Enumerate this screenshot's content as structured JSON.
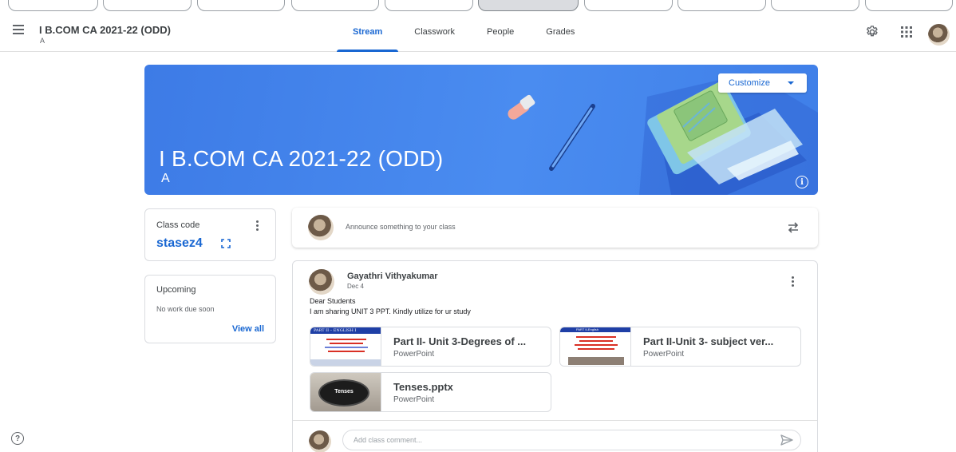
{
  "header": {
    "class_name": "I B.COM CA 2021-22 (ODD)",
    "section": "A",
    "tabs": [
      {
        "label": "Stream",
        "active": true
      },
      {
        "label": "Classwork",
        "active": false
      },
      {
        "label": "People",
        "active": false
      },
      {
        "label": "Grades",
        "active": false
      }
    ],
    "icons": [
      "menu-icon",
      "settings-icon",
      "apps-icon",
      "account-avatar"
    ]
  },
  "banner": {
    "title": "I B.COM CA 2021-22 (ODD)",
    "section": "A",
    "customize_label": "Customize",
    "color": "#4285f4"
  },
  "class_code": {
    "label": "Class code",
    "code": "stasez4"
  },
  "upcoming": {
    "label": "Upcoming",
    "message": "No work due soon",
    "view_all": "View all"
  },
  "announce": {
    "placeholder": "Announce something to your class"
  },
  "post": {
    "author": "Gayathri Vithyakumar",
    "date": "Dec 4",
    "line1": "Dear Students",
    "line2": "I am sharing UNIT 3 PPT. Kindly utilize for ur study",
    "attachments": [
      {
        "name": "Part II- Unit 3-Degrees of ...",
        "type": "PowerPoint",
        "thumb_heading": "PART II – ENGLISH I"
      },
      {
        "name": "Part II-Unit 3- subject ver...",
        "type": "PowerPoint",
        "thumb_heading": "PART II-English"
      },
      {
        "name": "Tenses.pptx",
        "type": "PowerPoint",
        "thumb_heading": "Tenses"
      }
    ],
    "comment_placeholder": "Add class comment..."
  },
  "colors": {
    "accent": "#1967d2",
    "banner": "#4285f4",
    "text": "#3c4043"
  }
}
